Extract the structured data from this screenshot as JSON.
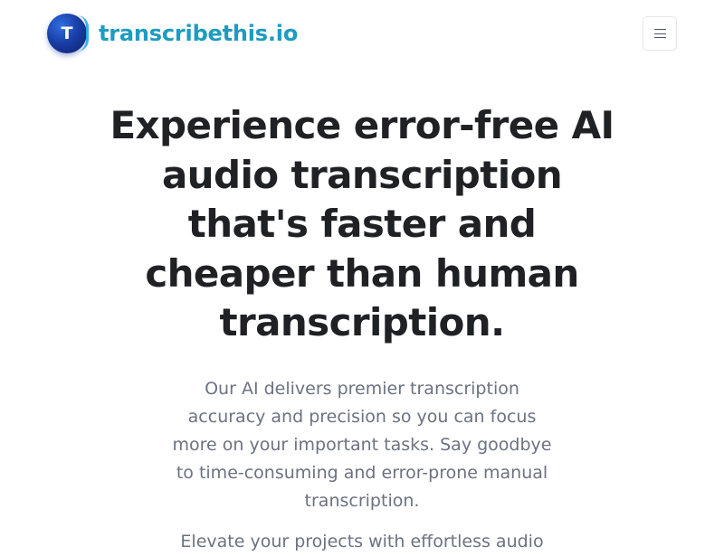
{
  "header": {
    "logo_letter": "T",
    "brand_name": "transcribethis.io",
    "menu_icon": "hamburger-menu-icon"
  },
  "hero": {
    "headline": "Experience error-free AI audio transcription that's faster and cheaper than human transcription.",
    "description": "Our AI delivers premier transcription accuracy and precision so you can focus more on your important tasks. Say goodbye to time-consuming and error-prone manual transcription.",
    "description_2": "Elevate your projects with effortless audio"
  },
  "colors": {
    "brand": "#1e9cc0",
    "logo_dark": "#0b1f6b",
    "logo_light": "#2f6fe0",
    "headline": "#1f2125",
    "body_text": "#6b7280"
  }
}
